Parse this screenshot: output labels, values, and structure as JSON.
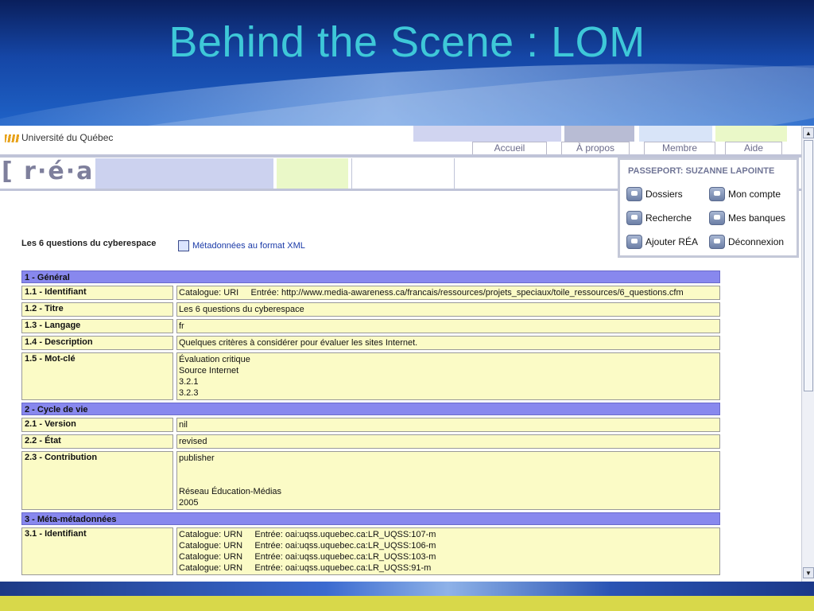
{
  "slide": {
    "title": "Behind the Scene : LOM"
  },
  "header": {
    "university": "Université du Québec",
    "logo": "[ r·é·a ]",
    "tabs": [
      "Accueil",
      "À propos",
      "Membre",
      "Aide"
    ]
  },
  "passport": {
    "heading": "PASSEPORT: SUZANNE LAPOINTE",
    "items": [
      {
        "label": "Dossiers",
        "icon": "folder-icon"
      },
      {
        "label": "Mon compte",
        "icon": "account-icon"
      },
      {
        "label": "Recherche",
        "icon": "search-icon"
      },
      {
        "label": "Mes banques",
        "icon": "bank-icon"
      },
      {
        "label": "Ajouter RÉA",
        "icon": "add-icon"
      },
      {
        "label": "Déconnexion",
        "icon": "logout-icon"
      }
    ]
  },
  "document": {
    "title": "Les 6 questions du cyberespace",
    "xml_link": "Métadonnées au format XML"
  },
  "lom": [
    {
      "section": "1 - Général",
      "rows": [
        {
          "label": "1.1 - Identifiant",
          "lines": [
            "Catalogue: URI     Entrée: http://www.media-awareness.ca/francais/ressources/projets_speciaux/toile_ressources/6_questions.cfm"
          ]
        },
        {
          "label": "1.2 - Titre",
          "lines": [
            "Les 6 questions du cyberespace"
          ]
        },
        {
          "label": "1.3 - Langage",
          "lines": [
            "fr"
          ]
        },
        {
          "label": "1.4 - Description",
          "lines": [
            "Quelques critères à considérer pour évaluer les sites Internet."
          ]
        },
        {
          "label": "1.5 - Mot-clé",
          "lines": [
            "Évaluation critique",
            "Source Internet",
            "3.2.1",
            "3.2.3"
          ]
        }
      ]
    },
    {
      "section": "2 - Cycle de vie",
      "rows": [
        {
          "label": "2.1 - Version",
          "lines": [
            "nil"
          ]
        },
        {
          "label": "2.2 - État",
          "lines": [
            "revised"
          ]
        },
        {
          "label": "2.3 - Contribution",
          "lines": [
            "publisher",
            "",
            "",
            "Réseau Éducation-Médias",
            "2005"
          ]
        }
      ]
    },
    {
      "section": "3 - Méta-métadonnées",
      "rows": [
        {
          "label": "3.1 - Identifiant",
          "lines": [
            "Catalogue: URN     Entrée: oai:uqss.uquebec.ca:LR_UQSS:107-m",
            "Catalogue: URN     Entrée: oai:uqss.uquebec.ca:LR_UQSS:106-m",
            "Catalogue: URN     Entrée: oai:uqss.uquebec.ca:LR_UQSS:103-m",
            "Catalogue: URN     Entrée: oai:uqss.uquebec.ca:LR_UQSS:91-m"
          ]
        }
      ]
    }
  ],
  "colors": {
    "title": "#3ec8d8",
    "section_bg": "#8888ee",
    "cell_bg": "#fbfbc6"
  }
}
